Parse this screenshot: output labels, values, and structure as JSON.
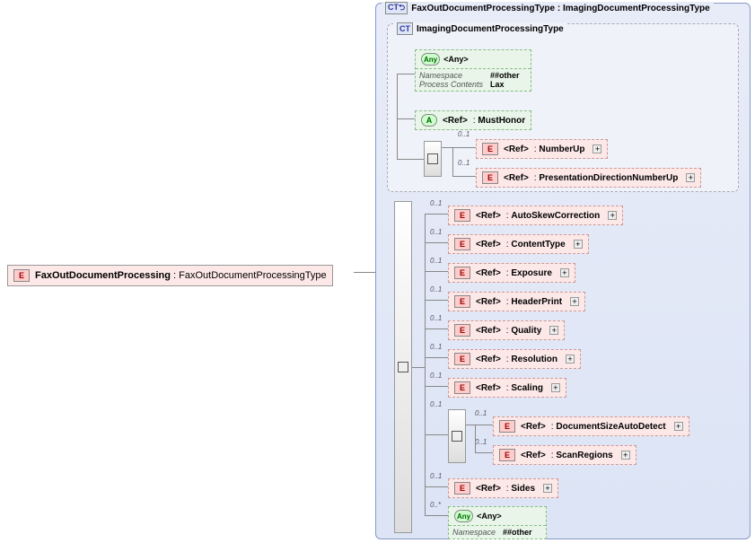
{
  "root": {
    "badge": "E",
    "name": "FaxOutDocumentProcessing",
    "type": "FaxOutDocumentProcessingType"
  },
  "outer_ct": {
    "badge": "CT",
    "name": "FaxOutDocumentProcessingType",
    "base": "ImagingDocumentProcessingType"
  },
  "inner_ct": {
    "badge": "CT",
    "name": "ImagingDocumentProcessingType"
  },
  "any1": {
    "label": "<Any>",
    "ns_label": "Namespace",
    "ns_val": "##other",
    "pc_label": "Process Contents",
    "pc_val": "Lax"
  },
  "attr": {
    "label": "<Ref>",
    "name": "MustHonor"
  },
  "inner_refs": [
    {
      "card": "0..1",
      "label": "<Ref>",
      "name": "NumberUp"
    },
    {
      "card": "0..1",
      "label": "<Ref>",
      "name": "PresentationDirectionNumberUp"
    }
  ],
  "outer_refs": [
    {
      "card": "0..1",
      "label": "<Ref>",
      "name": "AutoSkewCorrection"
    },
    {
      "card": "0..1",
      "label": "<Ref>",
      "name": "ContentType"
    },
    {
      "card": "0..1",
      "label": "<Ref>",
      "name": "Exposure"
    },
    {
      "card": "0..1",
      "label": "<Ref>",
      "name": "HeaderPrint"
    },
    {
      "card": "0..1",
      "label": "<Ref>",
      "name": "Quality"
    },
    {
      "card": "0..1",
      "label": "<Ref>",
      "name": "Resolution"
    },
    {
      "card": "0..1",
      "label": "<Ref>",
      "name": "Scaling"
    }
  ],
  "nested_seq_refs": [
    {
      "card": "0..1",
      "label": "<Ref>",
      "name": "DocumentSizeAutoDetect"
    },
    {
      "card": "0..1",
      "label": "<Ref>",
      "name": "ScanRegions"
    }
  ],
  "sides": {
    "card": "0..1",
    "label": "<Ref>",
    "name": "Sides"
  },
  "any2": {
    "card": "0..*",
    "label": "<Any>",
    "ns_label": "Namespace",
    "ns_val": "##other"
  },
  "nested_seq_card": "0..1"
}
